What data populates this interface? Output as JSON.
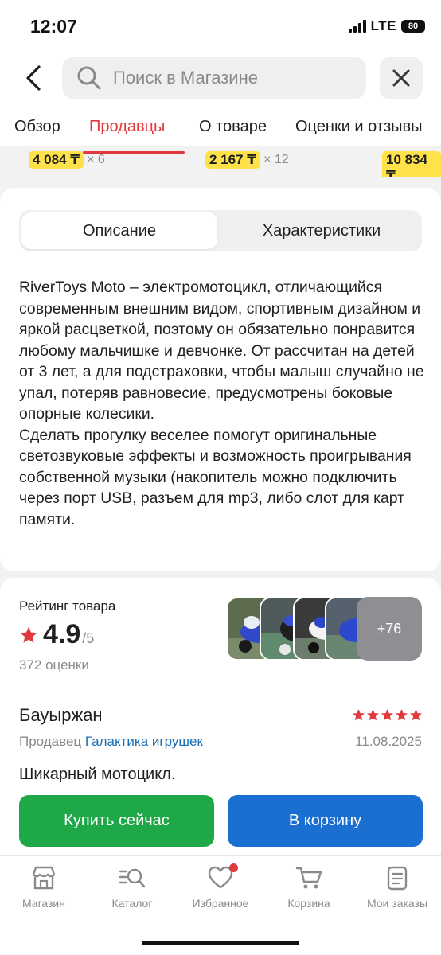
{
  "status_bar": {
    "time": "12:07",
    "network": "LTE",
    "battery": "80"
  },
  "search": {
    "placeholder": "Поиск в Магазине"
  },
  "tabs": [
    {
      "label": "Обзор"
    },
    {
      "label": "Продавцы"
    },
    {
      "label": "О товаре"
    },
    {
      "label": "Оценки и отзывы"
    }
  ],
  "prices": [
    {
      "price": "4 084 ₸",
      "qty": "× 6"
    },
    {
      "price": "2 167 ₸",
      "qty": "× 12"
    },
    {
      "price": "10 834 ₸",
      "qty": ""
    }
  ],
  "description_card": {
    "segment_active": "Описание",
    "segment_inactive": "Характеристики",
    "paragraph1": "RiverToys Moto – электромотоцикл, отличающийся современным внешним видом, спортивным дизайном и яркой расцветкой, поэтому он обязательно понравится любому мальчишке и девчонке. От рассчитан на детей от 3 лет, а для подстраховки, чтобы малыш случайно не упал, потеряв равновесие, предусмотрены боковые опорные колесики.",
    "paragraph2": "Сделать прогулку веселее помогут оригинальные светозвуковые эффекты и возможность проигрывания собственной музыки (накопитель можно подключить через порт USB, разъем для mp3, либо слот для карт памяти."
  },
  "rating": {
    "label": "Рейтинг товара",
    "value": "4.9",
    "max": "/5",
    "count": "372 оценки",
    "more_photos": "+76"
  },
  "review": {
    "author": "Бауыржан",
    "stars": 5,
    "seller_prefix": "Продавец",
    "seller_name": "Галактика игрушек",
    "date": "11.08.2025",
    "text": "Шикарный мотоцикл."
  },
  "actions": {
    "buy_now": "Купить сейчас",
    "add_to_cart": "В корзину"
  },
  "bottom_nav": [
    {
      "label": "Магазин",
      "icon": "shop-icon"
    },
    {
      "label": "Каталог",
      "icon": "catalog-search-icon"
    },
    {
      "label": "Избранное",
      "icon": "heart-icon"
    },
    {
      "label": "Корзина",
      "icon": "cart-icon"
    },
    {
      "label": "Мои заказы",
      "icon": "orders-icon"
    }
  ],
  "colors": {
    "accent_red": "#e03a3e",
    "buy_green": "#1fa848",
    "cart_blue": "#1a6fd1",
    "price_yellow": "#ffe14a",
    "link_blue": "#1a6fb5"
  }
}
